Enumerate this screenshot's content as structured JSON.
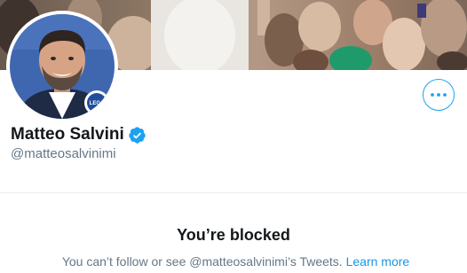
{
  "profile": {
    "display_name": "Matteo Salvini",
    "handle": "@matteosalvinimi",
    "verified": true
  },
  "avatar": {
    "badge_text": "LEGA"
  },
  "icons": {
    "more": "more-horizontal-icon",
    "verified": "verified-badge-icon"
  },
  "blocked": {
    "title": "You’re blocked",
    "message": "You can’t follow or see @matteosalvinimi’s Tweets.",
    "link_label": "Learn more"
  },
  "colors": {
    "accent": "#1da1f2",
    "link": "#1b95e0",
    "secondary_text": "#657786",
    "primary_text": "#14171a"
  }
}
